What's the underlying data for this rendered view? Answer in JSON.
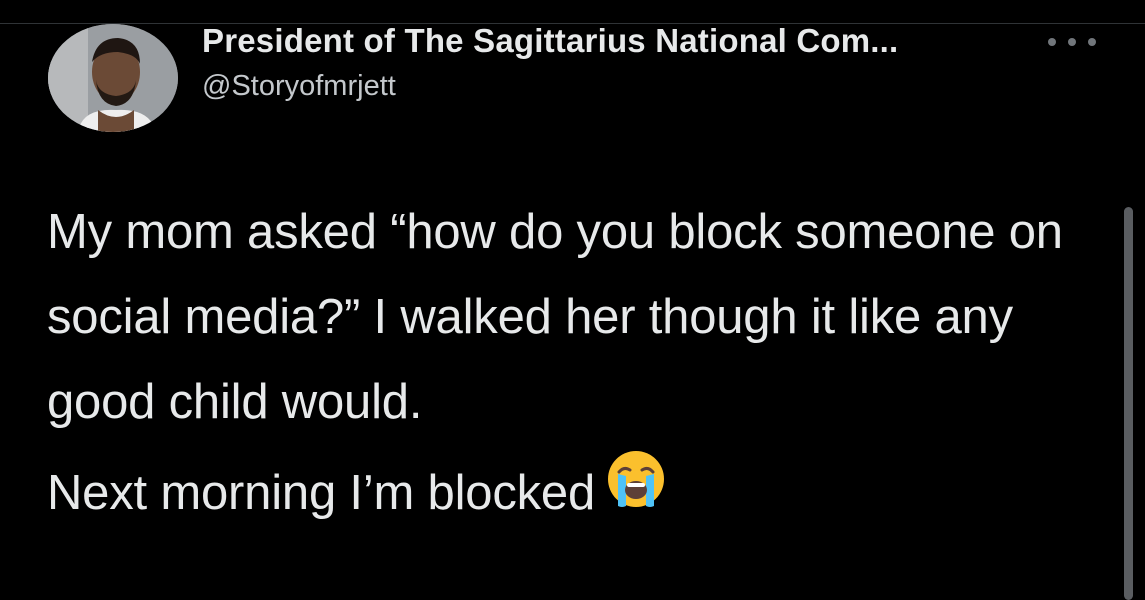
{
  "tweet": {
    "display_name": "President of The Sagittarius National Com...",
    "handle": "@Storyofmrjett",
    "paragraphs": [
      "My mom asked “how do you block someone on social media?” I walked her though it like any good child would.",
      "Next morning I’m blocked"
    ],
    "emoji": "loudly-crying-face"
  },
  "icons": {
    "more": "more-horizontal-icon",
    "avatar": "user-avatar-photo"
  },
  "colors": {
    "background": "#000000",
    "primary_text": "#e7e9ea",
    "secondary_text": "#71767b",
    "emoji_face": "#fbc02d",
    "emoji_tears": "#4fc3f7"
  }
}
